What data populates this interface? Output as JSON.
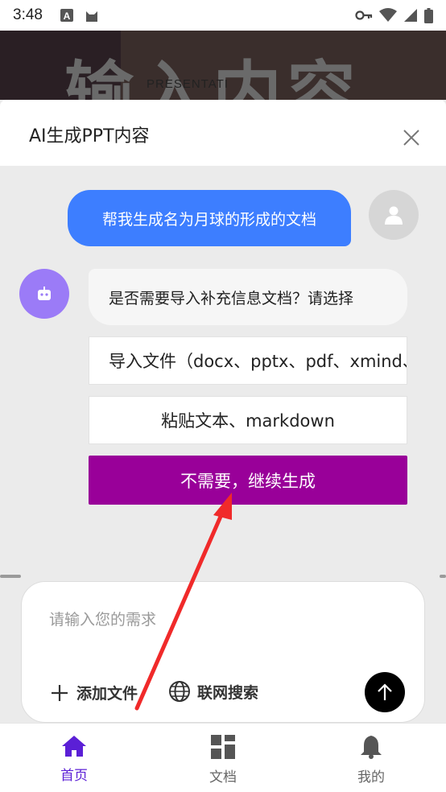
{
  "status_bar": {
    "time": "3:48",
    "icons": [
      "a-box-icon",
      "cat-icon",
      "key-icon",
      "wifi-icon",
      "signal-icon",
      "battery-icon"
    ]
  },
  "background": {
    "big_text": "输入内容",
    "small_text": "PRESENTATI"
  },
  "sheet": {
    "title": "AI生成PPT内容",
    "close_icon": "close-icon"
  },
  "chat": {
    "user_message": "帮我生成名为月球的形成的文档",
    "bot_message": "是否需要导入补充信息文档？请选择",
    "options": [
      "导入文件（docx、pptx、pdf、xmind、",
      "粘贴文本、markdown",
      "不需要，继续生成"
    ]
  },
  "input": {
    "placeholder": "请输入您的需求",
    "add_file_label": "添加文件",
    "web_search_label": "联网搜索"
  },
  "nav": {
    "items": [
      {
        "label": "首页",
        "icon": "home-icon",
        "active": true
      },
      {
        "label": "文档",
        "icon": "grid-icon",
        "active": false
      },
      {
        "label": "我的",
        "icon": "bell-icon",
        "active": false
      }
    ]
  },
  "colors": {
    "accent": "#5b1fd6",
    "user_bubble": "#3d7eff",
    "primary_option": "#990099",
    "bot_avatar": "#9b7bf7",
    "annotation_arrow": "#f02a2a"
  }
}
